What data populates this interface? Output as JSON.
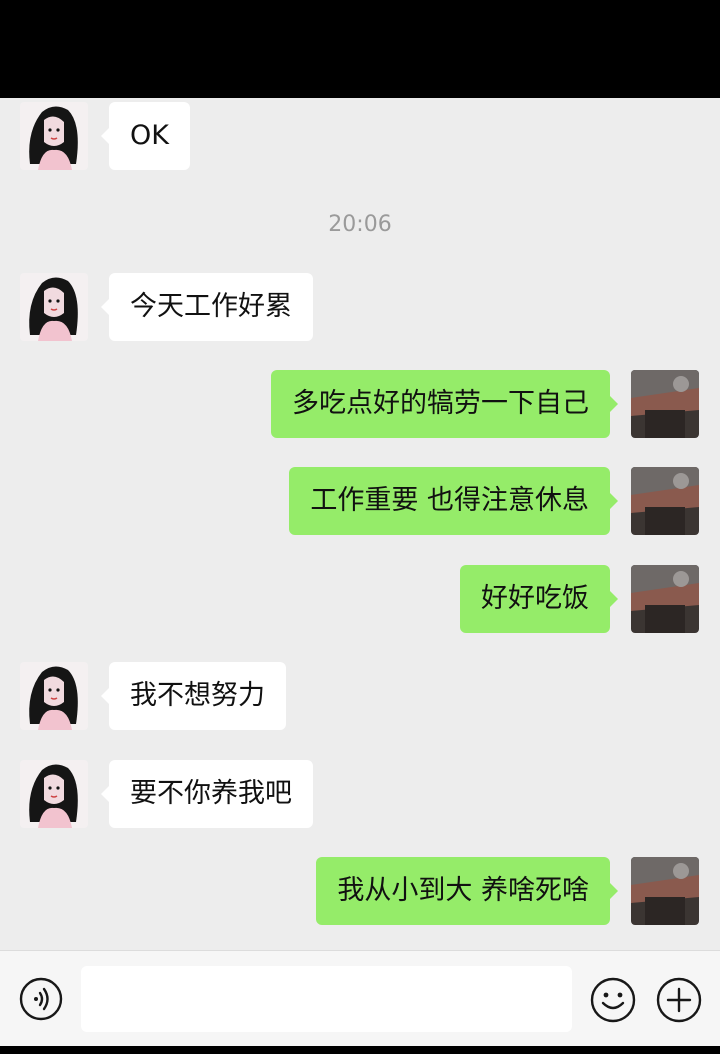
{
  "colors": {
    "background": "#ededed",
    "incoming_bubble": "#ffffff",
    "outgoing_bubble": "#95ec69",
    "timestamp_text": "#9a9a9a"
  },
  "messages": [
    {
      "side": "left",
      "text": "OK"
    },
    {
      "side": "timestamp",
      "text": "20:06"
    },
    {
      "side": "left",
      "text": "今天工作好累"
    },
    {
      "side": "right",
      "text": "多吃点好的犒劳一下自己"
    },
    {
      "side": "right",
      "text": "工作重要 也得注意休息"
    },
    {
      "side": "right",
      "text": "好好吃饭"
    },
    {
      "side": "left",
      "text": "我不想努力"
    },
    {
      "side": "left",
      "text": "要不你养我吧"
    },
    {
      "side": "right",
      "text": "我从小到大 养啥死啥"
    }
  ],
  "input_bar": {
    "value": "",
    "icons": [
      "voice-icon",
      "emoji-icon",
      "plus-icon"
    ]
  }
}
